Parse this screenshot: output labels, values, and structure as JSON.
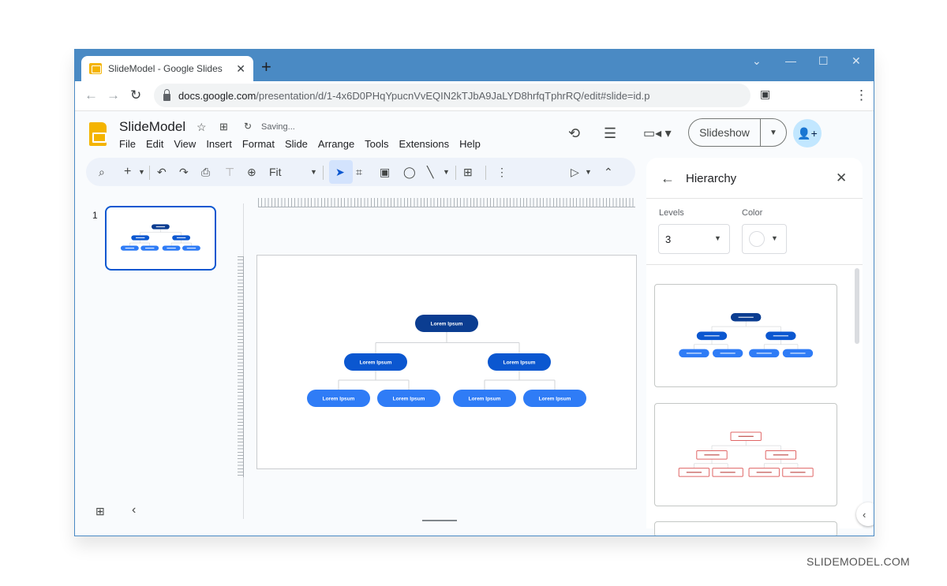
{
  "browser": {
    "tab_title": "SlideModel - Google Slides",
    "tab_close": "✕",
    "new_tab": "+",
    "controls": {
      "dropdown": "⌄",
      "minimize": "—",
      "maximize": "☐",
      "close": "✕"
    },
    "url_host": "docs.google.com",
    "url_path": "/presentation/d/1-4x6D0PHqYpucnVvEQIN2kTJbA9JaLYD8hrfqTphrRQ/edit#slide=id.p",
    "nav": {
      "back": "←",
      "forward": "→",
      "reload": "↻",
      "sidepanel": "▣",
      "menu": "⋮"
    }
  },
  "app": {
    "doc_title": "SlideModel",
    "status": "Saving...",
    "menu": [
      "File",
      "Edit",
      "View",
      "Insert",
      "Format",
      "Slide",
      "Arrange",
      "Tools",
      "Extensions",
      "Help"
    ],
    "slideshow_label": "Slideshow",
    "share_icon": "👤+"
  },
  "toolbar": {
    "zoom_label": "Fit"
  },
  "filmstrip": {
    "slides": [
      {
        "number": "1"
      }
    ]
  },
  "slide": {
    "diagram": {
      "root": {
        "label": "Lorem Ipsum",
        "color": "#0b3d91"
      },
      "level2": [
        {
          "label": "Lorem Ipsum",
          "color": "#0b57d0"
        },
        {
          "label": "Lorem Ipsum",
          "color": "#0b57d0"
        }
      ],
      "level3": [
        {
          "label": "Lorem Ipsum",
          "color": "#2f7cf6"
        },
        {
          "label": "Lorem Ipsum",
          "color": "#2f7cf6"
        },
        {
          "label": "Lorem Ipsum",
          "color": "#2f7cf6"
        },
        {
          "label": "Lorem Ipsum",
          "color": "#2f7cf6"
        }
      ]
    }
  },
  "panel": {
    "title": "Hierarchy",
    "levels_label": "Levels",
    "levels_value": "3",
    "color_label": "Color",
    "templates": [
      {
        "style": "filled-blue",
        "colors": [
          "#0b3d91",
          "#0b57d0",
          "#2f7cf6"
        ]
      },
      {
        "style": "outlined-red",
        "colors": [
          "#e06666",
          "#e06666",
          "#e06666"
        ]
      }
    ]
  },
  "watermark": "SLIDEMODEL.COM"
}
